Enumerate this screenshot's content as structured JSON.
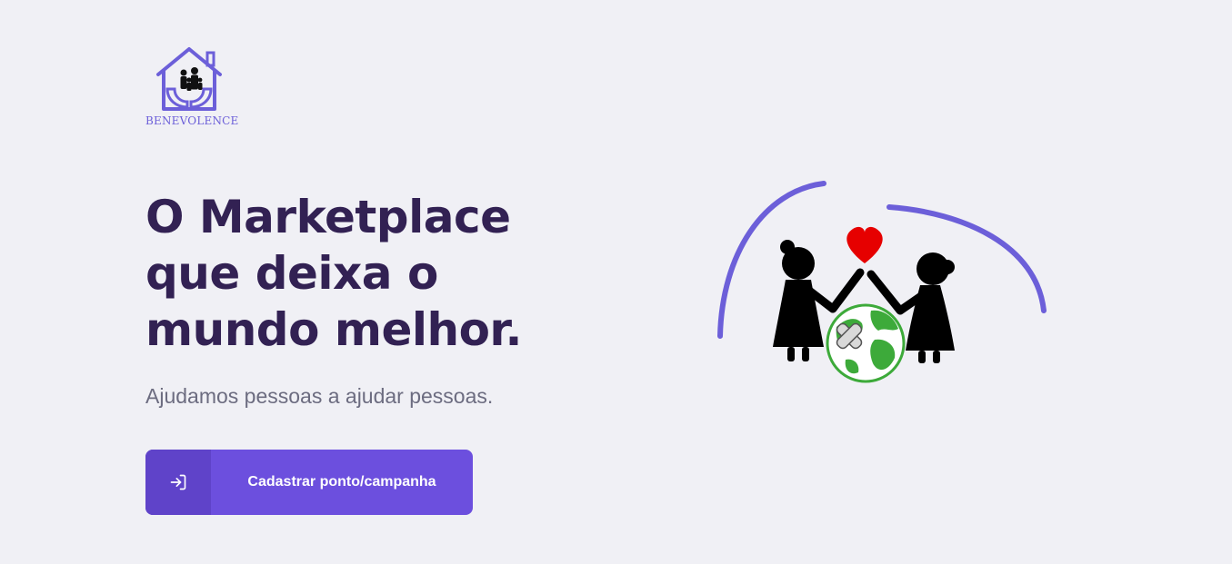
{
  "brand": {
    "name": "BENEVOLENCE",
    "logo_icon": "house-with-hands-family-icon",
    "color": "#6C5FD9"
  },
  "hero": {
    "title": "O Marketplace que deixa o mundo melhor.",
    "subtitle": "Ajudamos pessoas a ajudar pessoas.",
    "title_color": "#322153",
    "subtitle_color": "#6C6C80"
  },
  "cta": {
    "label": "Cadastrar ponto/campanha",
    "icon": "log-in-icon",
    "color": "#6C4FDE",
    "icon_bg_color": "#5F43C9"
  },
  "illustration": {
    "icon": "people-holding-heart-globe-icon",
    "arc_color": "#6C5FD9",
    "heart_color": "#E60000",
    "globe_color": "#3DAA3A"
  },
  "background_color": "#F0F0F5"
}
